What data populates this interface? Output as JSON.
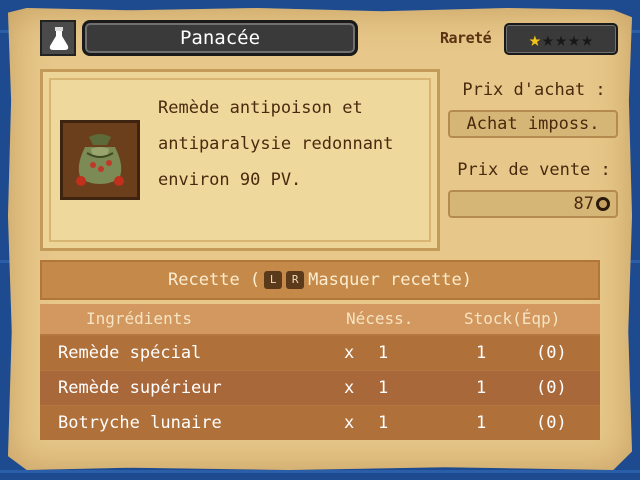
{
  "item": {
    "name": "Panacée",
    "icon": "flask-icon",
    "description_lines": [
      "Remède antipoison et",
      "antiparalysie redonnant",
      "environ 90 PV."
    ]
  },
  "rarity": {
    "label": "Rareté",
    "stars_filled": 1,
    "stars_total": 5
  },
  "prices": {
    "buy_label": "Prix d'achat :",
    "buy_value": "Achat imposs.",
    "sell_label": "Prix de vente :",
    "sell_value": "87"
  },
  "recipe": {
    "header_prefix": "Recette (",
    "key_l": "L",
    "key_r": "R",
    "header_action": "Masquer recette)",
    "columns": {
      "ingredients": "Ingrédients",
      "required": "Nécess.",
      "stock": "Stock(Éqp)"
    },
    "rows": [
      {
        "name": "Remède spécial",
        "mult": "x",
        "required": "1",
        "stock": "1",
        "equipped": "(0)"
      },
      {
        "name": "Remède supérieur",
        "mult": "x",
        "required": "1",
        "stock": "1",
        "equipped": "(0)"
      },
      {
        "name": "Botryche lunaire",
        "mult": "x",
        "required": "1",
        "stock": "1",
        "equipped": "(0)"
      }
    ]
  },
  "colors": {
    "star_on": "#f3c51b",
    "star_off": "#181818",
    "parchment": "#e7c88a",
    "background": "#1e4b8f"
  }
}
